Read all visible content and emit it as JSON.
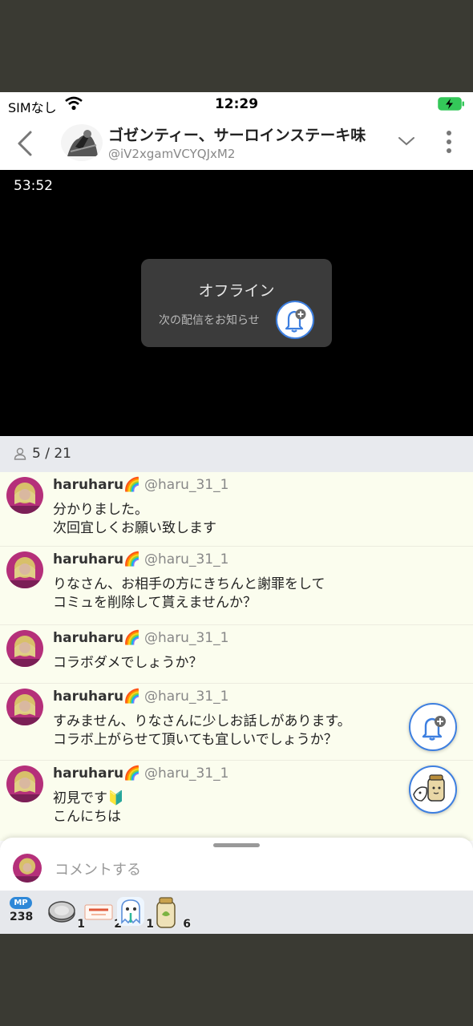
{
  "status_bar": {
    "carrier": "SIMなし",
    "time": "12:29"
  },
  "header": {
    "title": "ゴゼンティー、サーロインステーキ味",
    "user_id": "@iV2xgamVCYQJxM2"
  },
  "player": {
    "elapsed": "53:52",
    "offline_title": "オフライン",
    "notify_label": "次の配信をお知らせ"
  },
  "viewers": {
    "count": "5 / 21"
  },
  "comments": [
    {
      "name": "haruharu🌈",
      "handle": "@haru_31_1",
      "lines": [
        "分かりました。",
        "次回宜しくお願い致します"
      ]
    },
    {
      "name": "haruharu🌈",
      "handle": "@haru_31_1",
      "lines": [
        "りなさん、お相手の方にきちんと謝罪をして",
        "コミュを削除して貰えませんか？"
      ]
    },
    {
      "name": "haruharu🌈",
      "handle": "@haru_31_1",
      "lines": [
        "コラボダメでしょうか？"
      ]
    },
    {
      "name": "haruharu🌈",
      "handle": "@haru_31_1",
      "lines": [
        "すみません、りなさんに少しお話しがあります。",
        "コラボ上がらせて頂いても宜しいでしょうか？"
      ]
    },
    {
      "name": "haruharu🌈",
      "handle": "@haru_31_1",
      "lines": [
        "初見です🔰",
        "こんにちは"
      ]
    }
  ],
  "comment_input": {
    "placeholder": "コメントする"
  },
  "gift_bar": {
    "mp_label": "MP",
    "mp_value": "238",
    "items": [
      {
        "icon": "coin-icon",
        "count": "1"
      },
      {
        "icon": "ticket-icon",
        "count": "2"
      },
      {
        "icon": "ghost-icon",
        "count": "1"
      },
      {
        "icon": "tea-icon",
        "count": "6"
      }
    ]
  },
  "colors": {
    "accent": "#3d7fe0",
    "battery": "#34c759",
    "comment_bg": "#fbfdee",
    "viewer_bar_bg": "#e8eaee"
  }
}
